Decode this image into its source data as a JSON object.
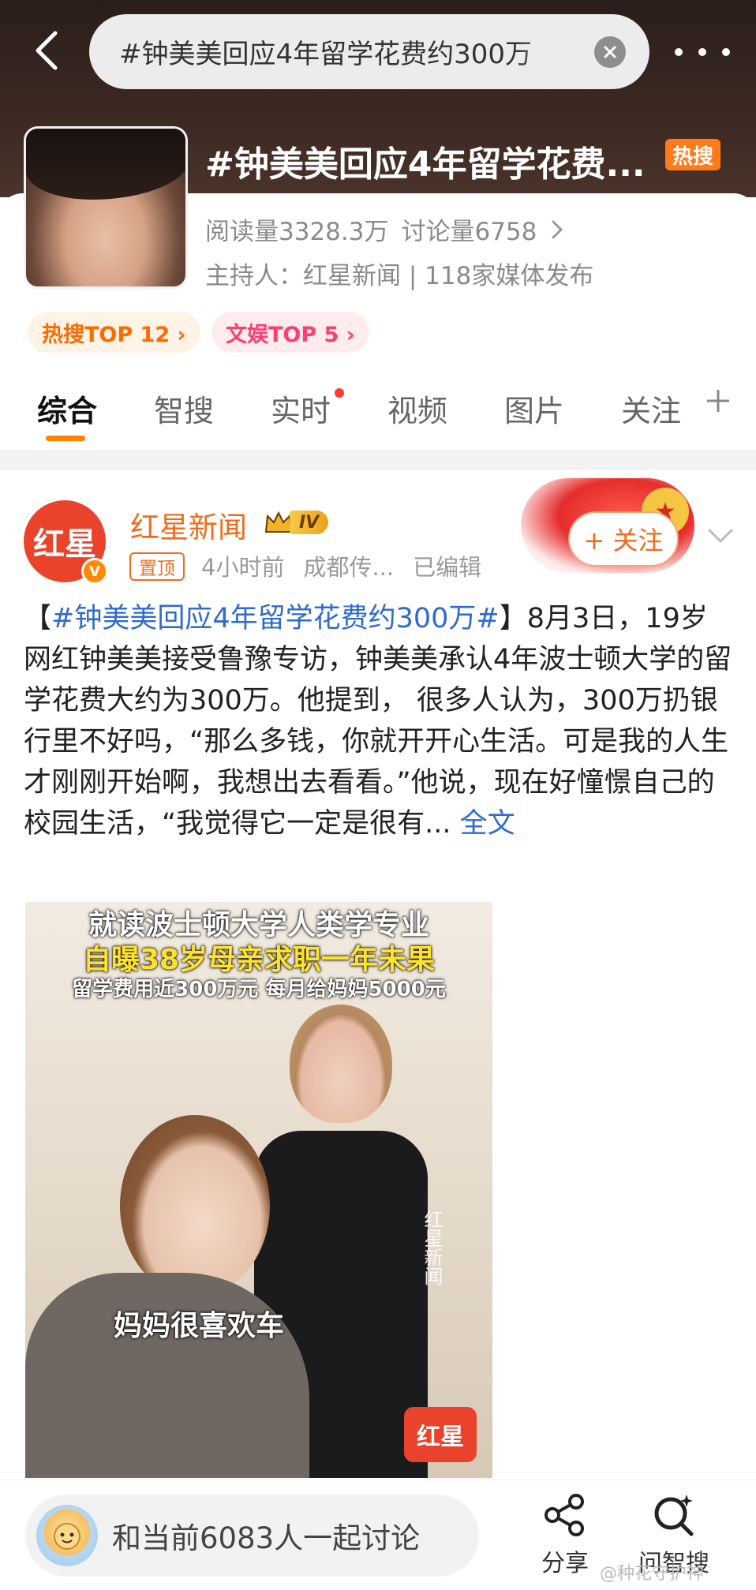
{
  "header": {
    "search_text": "#钟美美回应4年留学花费约300万",
    "topic_title": "#钟美美回应4年留学花费...",
    "hot_badge": "热搜",
    "read_count": "阅读量3328.3万",
    "discuss_count": "讨论量6758",
    "host": "主持人：红星新闻 | 118家媒体发布",
    "badges": [
      {
        "label": "热搜TOP 12 ›"
      },
      {
        "label": "文娱TOP 5 ›"
      }
    ]
  },
  "tabs": [
    {
      "label": "综合",
      "active": true
    },
    {
      "label": "智搜"
    },
    {
      "label": "实时",
      "has_dot": true
    },
    {
      "label": "视频"
    },
    {
      "label": "图片"
    },
    {
      "label": "关注"
    }
  ],
  "post": {
    "author_avatar_text": "红星",
    "author": "红星新闻",
    "level": "IV",
    "pinned": "置顶",
    "time": "4小时前",
    "location": "成都传...",
    "edited": "已编辑",
    "follow_label": "+ 关注",
    "hashtag": "#钟美美回应4年留学花费约300万#",
    "text_open": "【",
    "text_close": "】",
    "body": "8月3日，19岁网红钟美美接受鲁豫专访，钟美美承认4年波士顿大学的留学花费大约为300万。他提到， 很多人认为，300万扔银行里不好吗，“那么多钱，你就开开心生活。可是我的人生才刚刚开始啊，我想出去看看。”他说，现在好憧憬自己的校园生活，“我觉得它一定是很有...",
    "full_text_link": " 全文",
    "video": {
      "caption_line1": "就读波士顿大学人类学专业",
      "caption_line2": "自曝38岁母亲求职一年未果",
      "caption_line3": "留学费用近300万元 每月给妈妈5000元",
      "subtitle": "妈妈很喜欢车",
      "watermark": "红星新闻",
      "corner_logo": "红星"
    }
  },
  "bottom_bar": {
    "discuss_placeholder": "和当前6083人一起讨论",
    "share_label": "分享",
    "ask_label": "问智搜",
    "watermark": "@种花守护神"
  },
  "colors": {
    "accent": "#ff8200",
    "author_orange": "#f26b1d",
    "link_blue": "#2f6bcf",
    "hot_badge": "#ff7a1a"
  }
}
